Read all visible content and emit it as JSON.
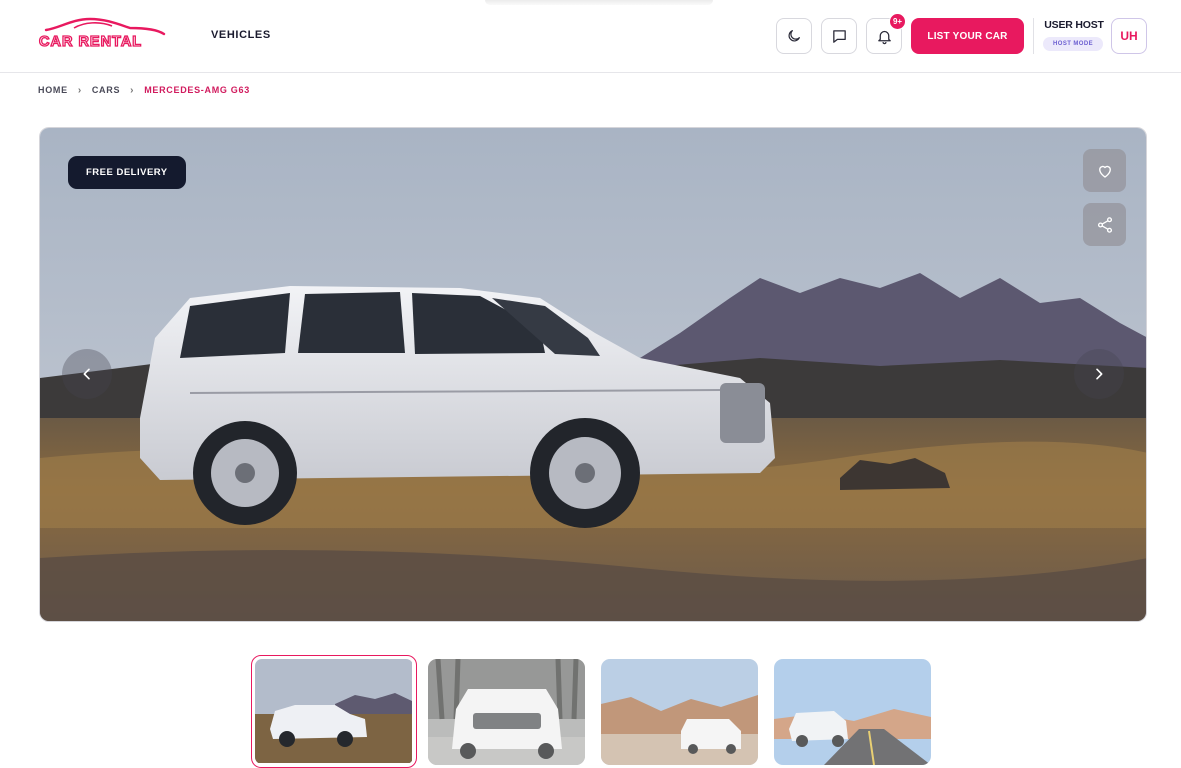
{
  "brand": {
    "logo_text": "CAR RENTAL",
    "accent_color": "#e8195f"
  },
  "nav": {
    "vehicles_label": "VEHICLES"
  },
  "header": {
    "theme_icon": "moon-icon",
    "messages_icon": "message-square-icon",
    "notifications_icon": "bell-icon",
    "notifications_badge": "9+",
    "list_car_label": "LIST YOUR CAR",
    "user_name": "USER HOST",
    "user_mode": "HOST MODE",
    "avatar_initials": "UH"
  },
  "breadcrumb": {
    "items": [
      "HOME",
      "CARS"
    ],
    "current": "MERCEDES-AMG G63"
  },
  "hero": {
    "badge": "FREE DELIVERY",
    "favorite_icon": "heart-icon",
    "share_icon": "share-icon",
    "prev_icon": "chevron-left-icon",
    "next_icon": "chevron-right-icon"
  },
  "thumbnails": [
    {
      "icon": "car-photo-desert-side",
      "active": true
    },
    {
      "icon": "car-photo-forest-front",
      "active": false
    },
    {
      "icon": "car-photo-canyon",
      "active": false
    },
    {
      "icon": "car-photo-road",
      "active": false
    }
  ]
}
